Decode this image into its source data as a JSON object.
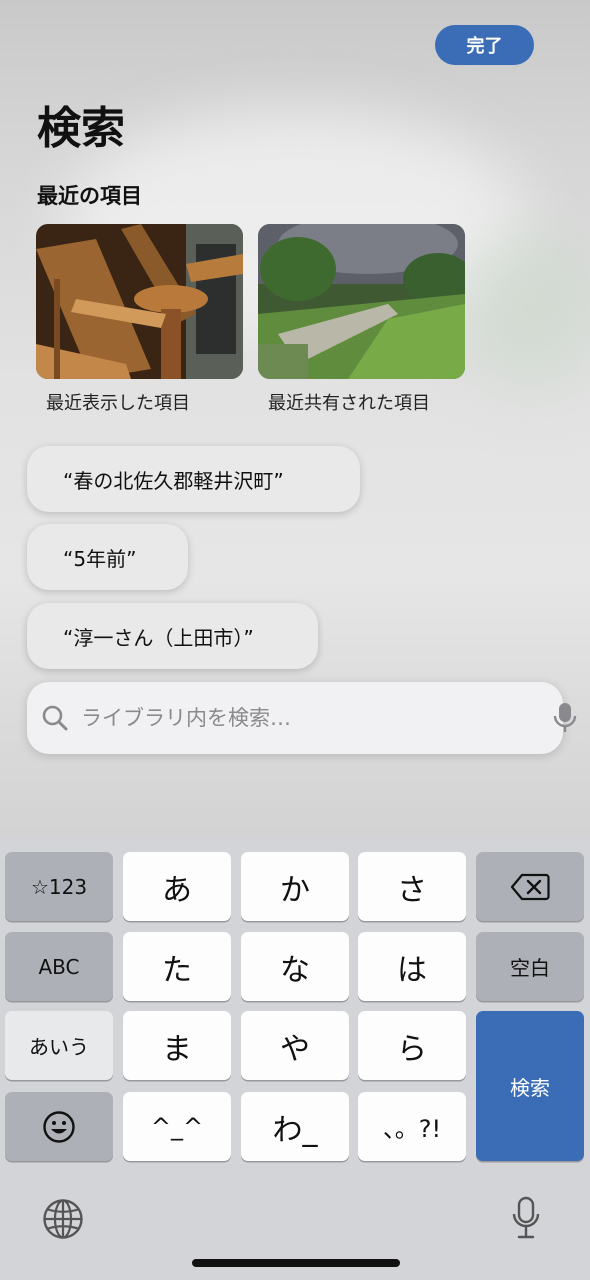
{
  "header": {
    "done_label": "完了",
    "title": "検索"
  },
  "recent": {
    "section_title": "最近の項目",
    "items": [
      {
        "label": "最近表示した項目"
      },
      {
        "label": "最近共有された項目"
      }
    ]
  },
  "suggestions": [
    "“春の北佐久郡軽井沢町”",
    "“5年前”",
    "“淳一さん（上田市）”"
  ],
  "search": {
    "placeholder": "ライブラリ内を検索…",
    "value": ""
  },
  "keyboard": {
    "rows": [
      [
        "☆123",
        "あ",
        "か",
        "さ",
        "delete"
      ],
      [
        "ABC",
        "た",
        "な",
        "は",
        "空白"
      ],
      [
        "あいう",
        "ま",
        "や",
        "ら",
        "検索"
      ],
      [
        "emoji",
        "^_^",
        "わ_",
        "、。?!"
      ]
    ],
    "accent_color": "#3a6db6"
  },
  "icons": [
    "search-icon",
    "microphone-icon",
    "delete-icon",
    "emoji-icon",
    "globe-icon"
  ]
}
